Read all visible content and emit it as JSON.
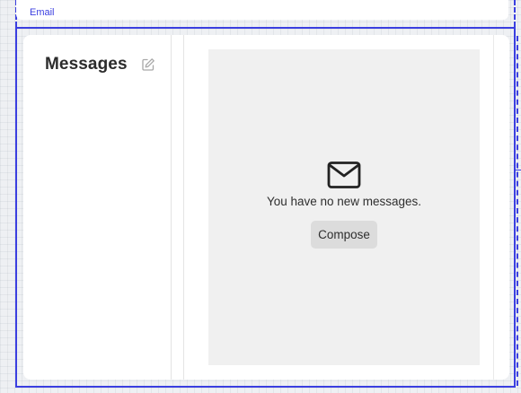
{
  "frame": {
    "label": "Email",
    "guide_color": "#3b3fe0"
  },
  "sidebar": {
    "title": "Messages",
    "edit_icon": "pencil-square-icon"
  },
  "content": {
    "empty_icon": "envelope-icon",
    "empty_message": "You have no new messages.",
    "compose_label": "Compose"
  },
  "colors": {
    "canvas": "#eef0f3",
    "panel": "#f0f0f0",
    "button": "#dcdcdc",
    "text": "#2c2c2c"
  }
}
